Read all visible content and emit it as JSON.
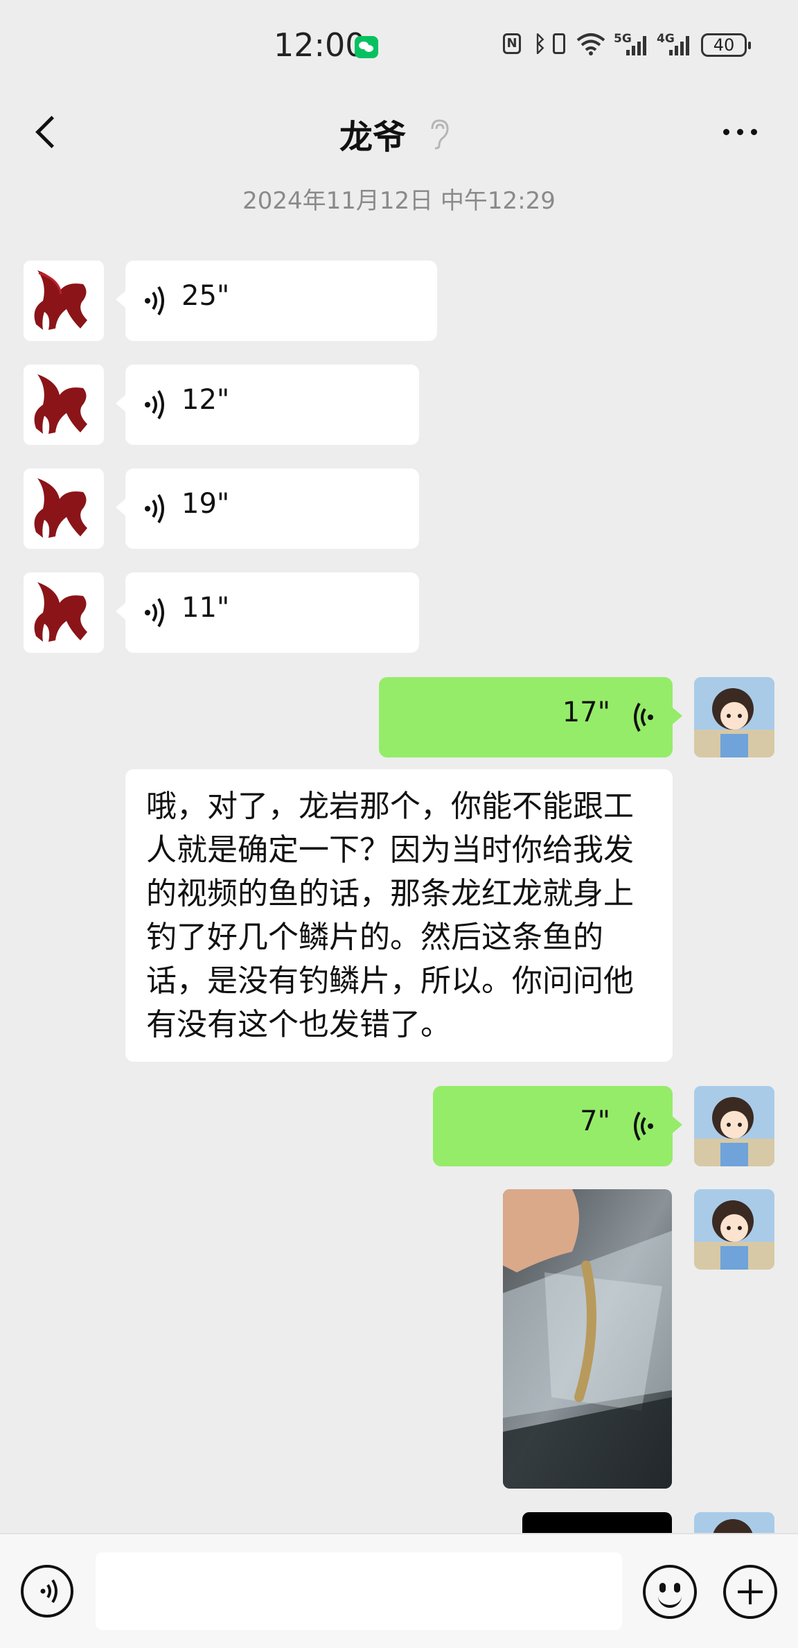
{
  "status": {
    "time": "12:00",
    "sig5g": "5G",
    "sig4g": "4G",
    "battery": "40"
  },
  "header": {
    "title": "龙爷"
  },
  "timestamp": "2024年11月12日 中午12:29",
  "messages": [
    {
      "side": "left",
      "type": "voice",
      "duration": "25\""
    },
    {
      "side": "left",
      "type": "voice",
      "duration": "12\""
    },
    {
      "side": "left",
      "type": "voice",
      "duration": "19\""
    },
    {
      "side": "left",
      "type": "voice",
      "duration": "11\""
    },
    {
      "side": "right",
      "type": "voice",
      "duration": "17\""
    },
    {
      "side": "left",
      "type": "text",
      "text": "哦，对了，龙岩那个，你能不能跟工人就是确定一下？因为当时你给我发的视频的鱼的话，那条龙红龙就身上钓了好几个鳞片的。然后这条鱼的话，是没有钓鳞片，所以。你问问他有没有这个也发错了。"
    },
    {
      "side": "right",
      "type": "voice",
      "duration": "7\""
    },
    {
      "side": "right",
      "type": "image"
    },
    {
      "side": "right",
      "type": "video"
    }
  ],
  "colors": {
    "background": "#ededed",
    "self_bubble": "#95ec69",
    "other_bubble": "#ffffff",
    "wechat_green": "#07c160"
  },
  "icons": [
    "back-icon",
    "ear-icon",
    "more-icon",
    "voice-wave-icon",
    "voice-toggle-icon",
    "emoji-icon",
    "plus-icon"
  ],
  "input": {
    "value": "",
    "placeholder": ""
  }
}
